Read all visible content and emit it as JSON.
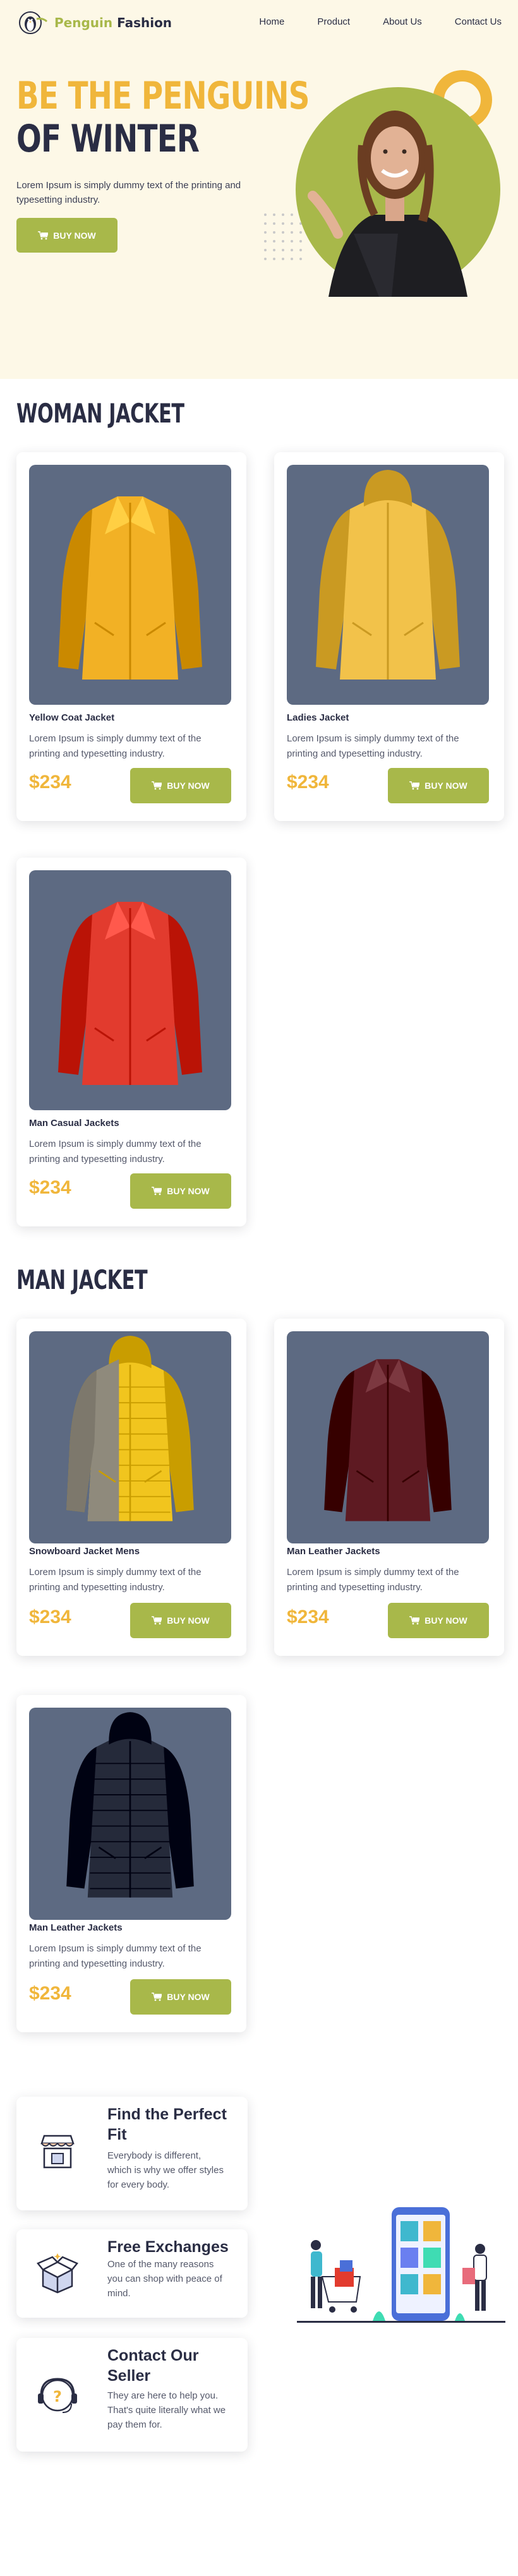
{
  "brand": {
    "name_part1": "Penguin",
    "name_part2": "Fashion"
  },
  "nav": {
    "items": [
      "Home",
      "Product",
      "About Us",
      "Contact Us"
    ]
  },
  "hero": {
    "title_line1": "BE THE PENGUINS",
    "title_line2": "OF WINTER",
    "subtitle": "Lorem Ipsum is simply dummy text of the printing and typesetting industry.",
    "button_label": "BUY NOW"
  },
  "sections": {
    "woman_title": "WOMAN JACKET",
    "man_title": "MAN JACKET"
  },
  "woman_products": [
    {
      "name": "Yellow Coat Jacket",
      "desc": "Lorem Ipsum is simply dummy text of the printing and typesetting industry.",
      "price": "$234",
      "button": "BUY NOW",
      "color": "#f2b125",
      "style": "coat"
    },
    {
      "name": "Ladies Jacket",
      "desc": "Lorem Ipsum is simply dummy text of the printing and typesetting industry.",
      "price": "$234",
      "button": "BUY NOW",
      "color": "#f2c24a",
      "style": "hood"
    },
    {
      "name": "Man Casual Jackets",
      "desc": "Lorem Ipsum is simply dummy text of the printing and typesetting industry.",
      "price": "$234",
      "button": "BUY NOW",
      "color": "#e23b2e",
      "style": "biker"
    }
  ],
  "man_products": [
    {
      "name": "Snowboard Jacket Mens",
      "desc": "Lorem Ipsum is simply dummy text of the printing and typesetting industry.",
      "price": "$234",
      "button": "BUY NOW",
      "color": "#f1c51e",
      "style": "puffer2"
    },
    {
      "name": "Man Leather Jackets",
      "desc": "Lorem Ipsum is simply dummy text of the printing and typesetting industry.",
      "price": "$234",
      "button": "BUY NOW",
      "color": "#5e1a22",
      "style": "leather"
    },
    {
      "name": "Man Leather Jackets",
      "desc": "Lorem Ipsum is simply dummy text of the printing and typesetting industry.",
      "price": "$234",
      "button": "BUY NOW",
      "color": "#252a3a",
      "style": "puffer"
    }
  ],
  "features": [
    {
      "title": "Find the Perfect Fit",
      "text": "Everybody is different, which is why we offer styles for every body.",
      "icon": "shop-icon"
    },
    {
      "title": "Free Exchanges",
      "text": "One of the many reasons you can shop with peace of mind.",
      "icon": "box-icon"
    },
    {
      "title": "Contact Our Seller",
      "text": "They are here to help you. That's quite literally what we pay them for.",
      "icon": "support-icon"
    }
  ],
  "colors": {
    "accent_green": "#a8b84a",
    "accent_yellow": "#f0b63b",
    "dark": "#2a2d44",
    "hero_bg": "#fdf8e7",
    "card_image_bg": "#5d6a82"
  }
}
